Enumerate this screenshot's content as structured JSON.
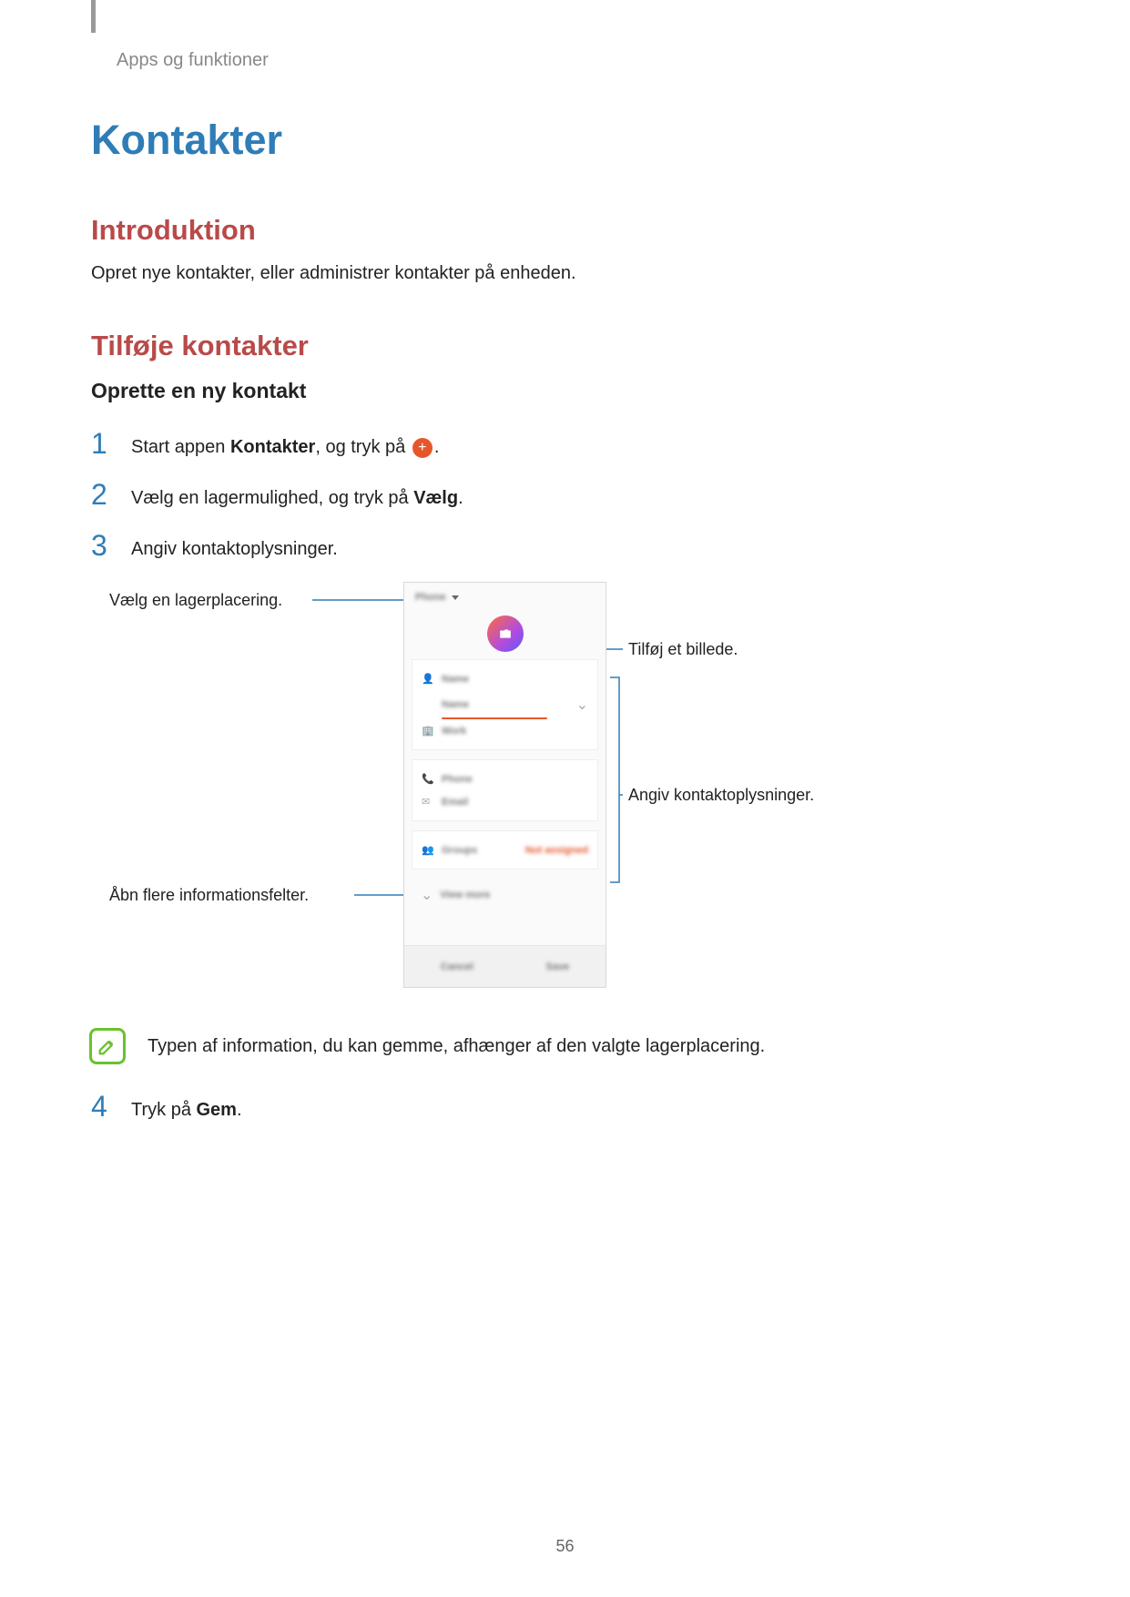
{
  "breadcrumb": "Apps og funktioner",
  "h1": "Kontakter",
  "section_intro": {
    "title": "Introduktion",
    "text": "Opret nye kontakter, eller administrer kontakter på enheden."
  },
  "section_add": {
    "title": "Tilføje kontakter",
    "subheading": "Oprette en ny kontakt",
    "steps": {
      "1": {
        "num": "1",
        "pre": "Start appen ",
        "bold": "Kontakter",
        "mid": ", og tryk på ",
        "post": "."
      },
      "2": {
        "num": "2",
        "pre": "Vælg en lagermulighed, og tryk på ",
        "bold": "Vælg",
        "post": "."
      },
      "3": {
        "num": "3",
        "text": "Angiv kontaktoplysninger."
      },
      "4": {
        "num": "4",
        "pre": "Tryk på ",
        "bold": "Gem",
        "post": "."
      }
    }
  },
  "callouts": {
    "storage": "Vælg en lagerplacering.",
    "image": "Tilføj et billede.",
    "info": "Angiv kontaktoplysninger.",
    "more_fields": "Åbn flere informationsfelter."
  },
  "phone_ui": {
    "storage_label": "Phone",
    "fields": {
      "name1": "Name",
      "name2": "Name",
      "work": "Work",
      "phone": "Phone",
      "email": "Email",
      "groups": "Groups",
      "not_assigned": "Not assigned",
      "view_more": "View more"
    },
    "actions": {
      "cancel": "Cancel",
      "save": "Save"
    }
  },
  "note": "Typen af information, du kan gemme, afhænger af den valgte lagerplacering.",
  "page_number": "56"
}
